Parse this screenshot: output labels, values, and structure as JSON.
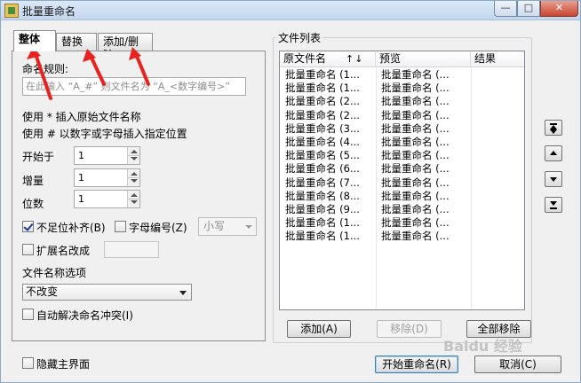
{
  "window": {
    "title": "批量重命名",
    "controls": {
      "minimize": "—",
      "maximize": "□",
      "close": "✕"
    }
  },
  "tabs": [
    {
      "label": "整体",
      "active": true
    },
    {
      "label": "替换",
      "active": false
    },
    {
      "label": "添加/删除",
      "active": false
    }
  ],
  "overall": {
    "rule_label": "命名规则:",
    "rule_placeholder": "在此输入 “A_#” 则文件名为 “A_<数字编号>”",
    "hint_star": "使用 * 插入原始文件名称",
    "hint_hash": "使用 # 以数字或字母插入指定位置",
    "start_label": "开始于",
    "start_value": "1",
    "step_label": "增量",
    "step_value": "1",
    "digits_label": "位数",
    "digits_value": "1",
    "pad_label": "不足位补齐(B)",
    "pad_checked": true,
    "letter_label": "字母编号(Z)",
    "letter_checked": false,
    "case_value": "小写",
    "ext_label": "扩展名改成",
    "ext_checked": false,
    "ext_value": "",
    "name_options_label": "文件名称选项",
    "name_option_value": "不改变",
    "auto_resolve_label": "自动解决命名冲突(I)",
    "auto_resolve_checked": false
  },
  "file_list": {
    "group_title": "文件列表",
    "columns": [
      "原文件名",
      "预览",
      "结果"
    ],
    "sort_icon": "↑↓",
    "rows": [
      [
        "批量重命名 (1...",
        "批量重命名 (..."
      ],
      [
        "批量重命名 (1...",
        "批量重命名 (..."
      ],
      [
        "批量重命名 (2...",
        "批量重命名 (..."
      ],
      [
        "批量重命名 (2...",
        "批量重命名 (..."
      ],
      [
        "批量重命名 (3...",
        "批量重命名 (..."
      ],
      [
        "批量重命名 (4...",
        "批量重命名 (..."
      ],
      [
        "批量重命名 (5...",
        "批量重命名 (..."
      ],
      [
        "批量重命名 (6...",
        "批量重命名 (..."
      ],
      [
        "批量重命名 (7...",
        "批量重命名 (..."
      ],
      [
        "批量重命名 (8...",
        "批量重命名 (..."
      ],
      [
        "批量重命名 (9...",
        "批量重命名 (..."
      ],
      [
        "批量重命名 (1...",
        "批量重命名 (..."
      ],
      [
        "批量重命名 (1...",
        "批量重命名 (..."
      ]
    ],
    "add_button": "添加(A)",
    "remove_button": "移除(D)",
    "remove_all_button": "全部移除"
  },
  "side_buttons": [
    "move-top-icon",
    "move-up-icon",
    "move-down-icon",
    "move-bottom-icon"
  ],
  "footer": {
    "hide_main_label": "隐藏主界面",
    "hide_main_checked": false,
    "start_button": "开始重命名(R)",
    "cancel_button": "取消(C)"
  },
  "watermark": "Baidu 经验",
  "colors": {
    "annotation_arrow": "#e8231f",
    "default_button_border": "#3c7fb1"
  }
}
